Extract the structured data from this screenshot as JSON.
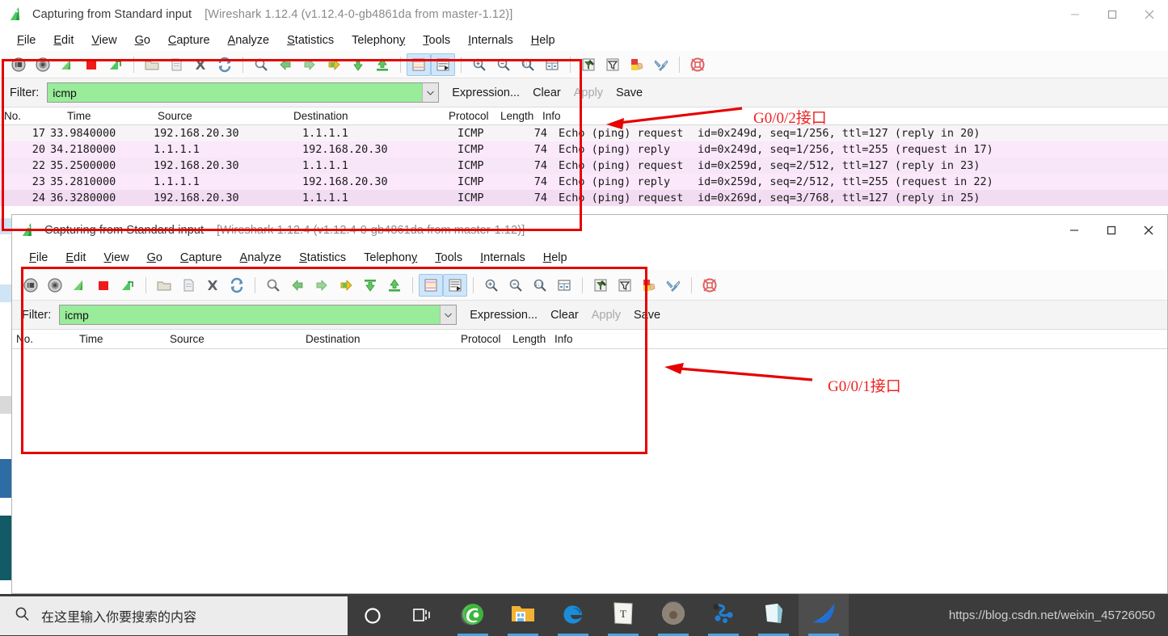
{
  "window1": {
    "title_main": "Capturing from Standard input",
    "title_detail": "[Wireshark 1.12.4  (v1.12.4-0-gb4861da from master-1.12)]",
    "menu": [
      "File",
      "Edit",
      "View",
      "Go",
      "Capture",
      "Analyze",
      "Statistics",
      "Telephony",
      "Tools",
      "Internals",
      "Help"
    ],
    "controls": {
      "minimize": "minimize-button",
      "maximize": "maximize-button",
      "close": "close-button"
    },
    "filter": {
      "label": "Filter:",
      "value": "icmp",
      "placeholder": "",
      "expression": "Expression...",
      "clear": "Clear",
      "apply": "Apply",
      "save": "Save"
    },
    "columns": [
      "No.",
      "Time",
      "Source",
      "Destination",
      "Protocol",
      "Length",
      "Info"
    ],
    "rows": [
      {
        "no": "17",
        "time": "33.9840000",
        "src": "192.168.20.30",
        "dst": "1.1.1.1",
        "proto": "ICMP",
        "len": "74",
        "info_desc": "Echo (ping) request",
        "info_detail": "id=0x249d, seq=1/256, ttl=127 (reply in 20)",
        "bg": "#f7f3f7"
      },
      {
        "no": "20",
        "time": "34.2180000",
        "src": "1.1.1.1",
        "dst": "192.168.20.30",
        "proto": "ICMP",
        "len": "74",
        "info_desc": "Echo (ping) reply",
        "info_detail": "id=0x249d, seq=1/256, ttl=255 (request in 17)",
        "bg": "#fbe8fb"
      },
      {
        "no": "22",
        "time": "35.2500000",
        "src": "192.168.20.30",
        "dst": "1.1.1.1",
        "proto": "ICMP",
        "len": "74",
        "info_desc": "Echo (ping) request",
        "info_detail": "id=0x259d, seq=2/512, ttl=127 (reply in 23)",
        "bg": "#f7e6f7"
      },
      {
        "no": "23",
        "time": "35.2810000",
        "src": "1.1.1.1",
        "dst": "192.168.20.30",
        "proto": "ICMP",
        "len": "74",
        "info_desc": "Echo (ping) reply",
        "info_detail": "id=0x259d, seq=2/512, ttl=255 (request in 22)",
        "bg": "#fbe8fb"
      },
      {
        "no": "24",
        "time": "36.3280000",
        "src": "192.168.20.30",
        "dst": "1.1.1.1",
        "proto": "ICMP",
        "len": "74",
        "info_desc": "Echo (ping) request",
        "info_detail": "id=0x269d, seq=3/768, ttl=127 (reply in 25)",
        "bg": "#f2dcf2"
      }
    ]
  },
  "window2": {
    "title_main": "Capturing from Standard input",
    "title_detail": "[Wireshark 1.12.4  (v1.12.4-0-gb4861da from master-1.12)]",
    "menu": [
      "File",
      "Edit",
      "View",
      "Go",
      "Capture",
      "Analyze",
      "Statistics",
      "Telephony",
      "Tools",
      "Internals",
      "Help"
    ],
    "filter": {
      "label": "Filter:",
      "value": "icmp",
      "placeholder": "",
      "expression": "Expression...",
      "clear": "Clear",
      "apply": "Apply",
      "save": "Save"
    },
    "columns": [
      "No.",
      "Time",
      "Source",
      "Destination",
      "Protocol",
      "Length",
      "Info"
    ],
    "rows": []
  },
  "annotations": {
    "label_top": "G0/0/2接口",
    "label_bottom": "G0/0/1接口",
    "color": "#ee2222"
  },
  "toolbar_icons": [
    "start-capture-icon",
    "capture-options-icon",
    "restart-capture-icon",
    "stop-capture-icon",
    "capture-interfaces-icon",
    "open-file-icon",
    "save-file-icon",
    "close-file-icon",
    "reload-icon",
    "find-packet-icon",
    "go-back-icon",
    "go-forward-icon",
    "go-to-packet-icon",
    "go-to-first-packet-icon",
    "go-to-last-packet-icon",
    "colorize-packet-list-icon",
    "auto-scroll-icon",
    "zoom-in-icon",
    "zoom-out-icon",
    "zoom-reset-icon",
    "resize-columns-icon",
    "capture-filters-icon",
    "display-filters-icon",
    "coloring-rules-icon",
    "preferences-icon",
    "help-icon"
  ],
  "taskbar": {
    "search_placeholder": "在这里输入你要搜索的内容",
    "search_icon": "search-icon",
    "cortana_icon": "cortana-circle-icon",
    "taskview_icon": "task-view-icon",
    "apps": [
      {
        "name": "360-browser-icon",
        "color": "#3db53d",
        "running": true
      },
      {
        "name": "file-explorer-icon",
        "color": "#f2b233",
        "running": true
      },
      {
        "name": "edge-browser-icon",
        "color": "#1a8cd8",
        "running": true
      },
      {
        "name": "text-editor-icon",
        "color": "#f0f0f0",
        "running": true
      },
      {
        "name": "user-photo-icon",
        "color": "#8a7f74",
        "running": true
      },
      {
        "name": "ensp-icon",
        "color": "#1f7fd4",
        "running": true
      },
      {
        "name": "virtualbox-icon",
        "color": "#9fd8e5",
        "running": true
      },
      {
        "name": "wireshark-icon",
        "color": "#1f6fd4",
        "running": true
      }
    ],
    "watermark": "https://blog.csdn.net/weixin_45726050"
  }
}
